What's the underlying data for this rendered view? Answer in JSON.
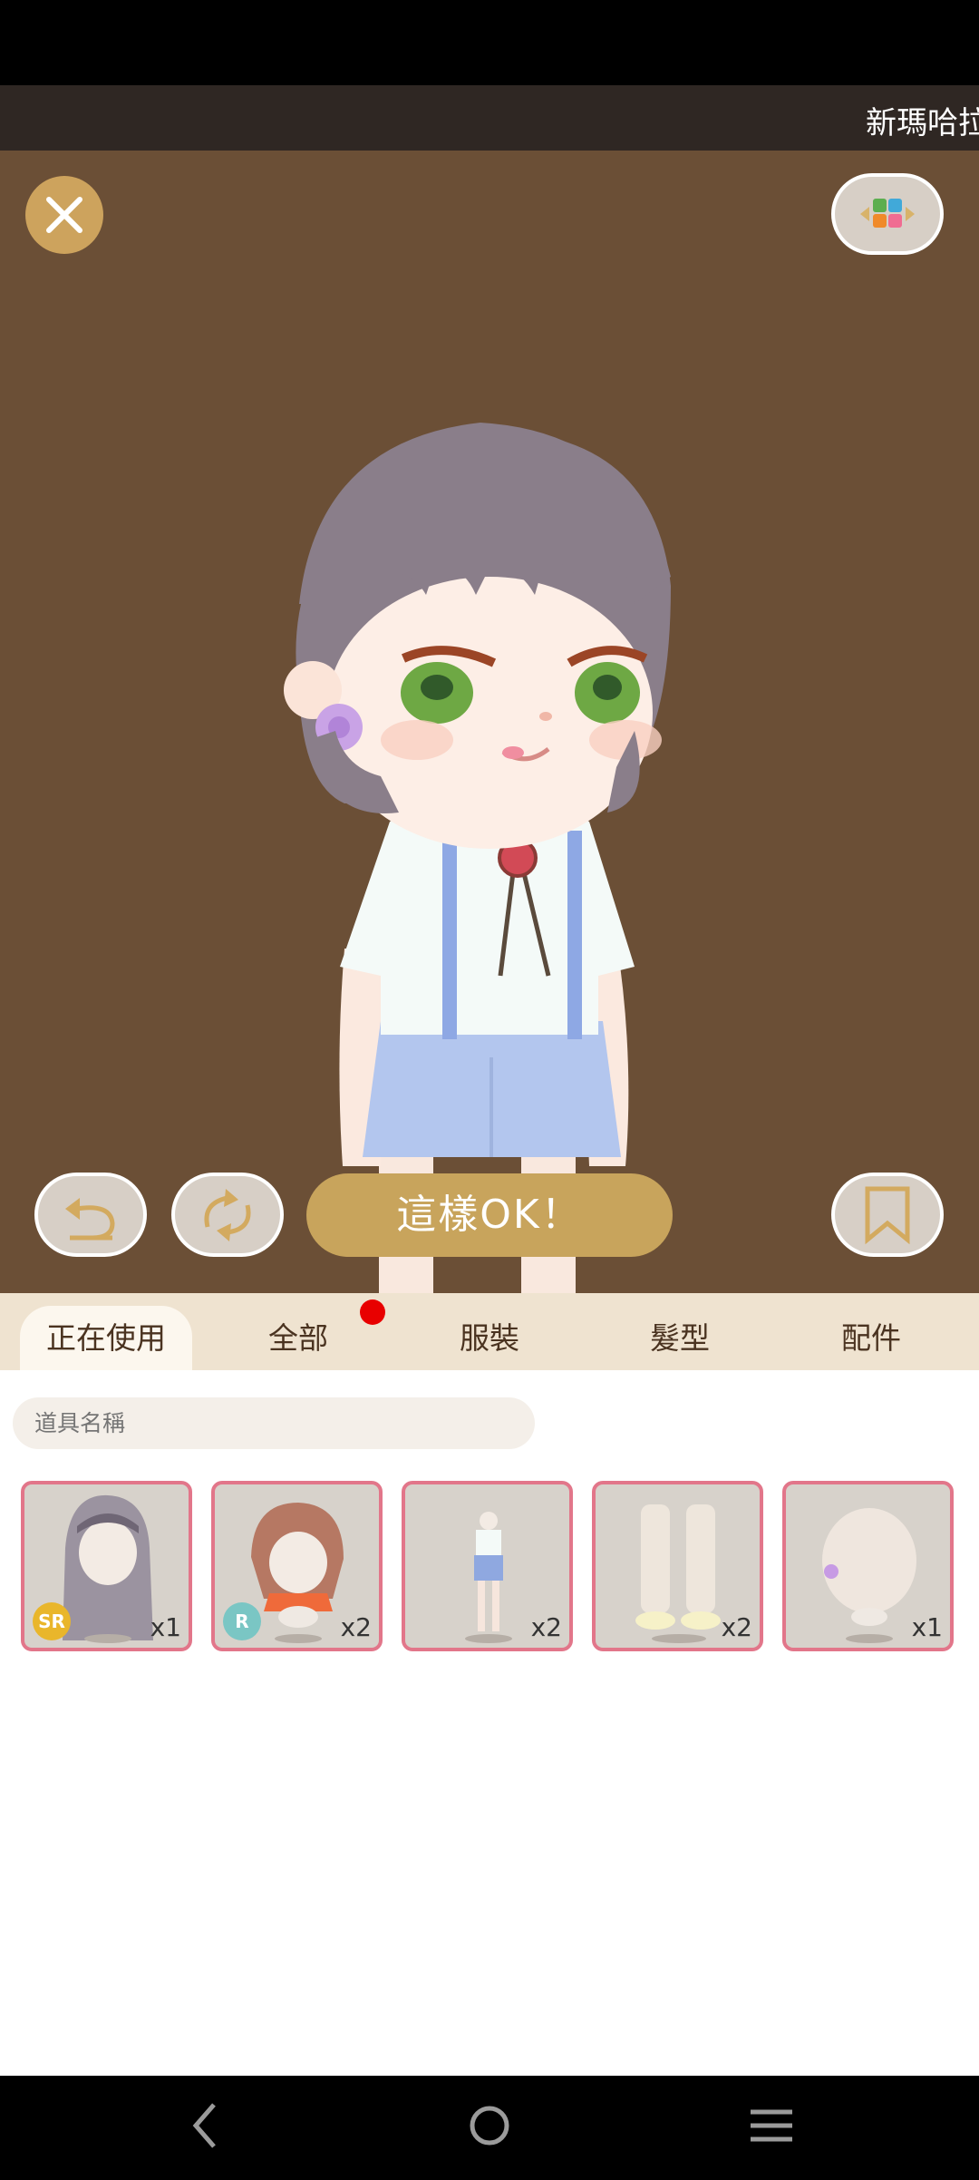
{
  "marquee": {
    "text": "新瑪哈拉"
  },
  "stage": {
    "confirm_label": "這樣OK！"
  },
  "tabs": [
    {
      "label": "正在使用",
      "active": true
    },
    {
      "label": "全部",
      "active": false,
      "badge": true
    },
    {
      "label": "服裝",
      "active": false
    },
    {
      "label": "髮型",
      "active": false
    },
    {
      "label": "配件",
      "active": false
    }
  ],
  "search": {
    "placeholder": "道具名稱"
  },
  "items": [
    {
      "name": "long-hair",
      "qty": "x1",
      "rarity": "SR",
      "rarity_color": "#e9b62b"
    },
    {
      "name": "short-red-hair",
      "qty": "x2",
      "rarity": "R",
      "rarity_color": "#7ac6c4"
    },
    {
      "name": "outfit",
      "qty": "x2",
      "rarity": ""
    },
    {
      "name": "socks-shoes",
      "qty": "x2",
      "rarity": ""
    },
    {
      "name": "flower-accessory",
      "qty": "x1",
      "rarity": ""
    }
  ],
  "colors": {
    "accent": "#c8a45c",
    "tab_bg": "#efe3d0",
    "item_border": "#e2768a",
    "stage_bg": "#6b4f36"
  }
}
